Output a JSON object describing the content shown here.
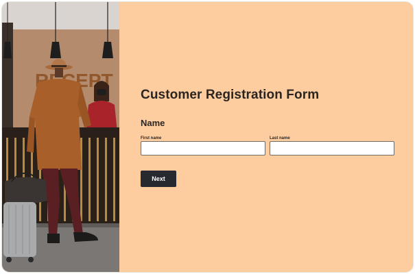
{
  "colors": {
    "background": "#fdcc9f",
    "button": "#262a2e",
    "text": "#2b2521",
    "input_border": "#6f6a66"
  },
  "photo": {
    "sign_text": "RECEPT",
    "alt": "hotel-reception-photo"
  },
  "form": {
    "title": "Customer Registration Form",
    "section_label": "Name",
    "first_name": {
      "label": "First name",
      "value": "",
      "placeholder": ""
    },
    "last_name": {
      "label": "Last name",
      "value": "",
      "placeholder": ""
    },
    "next_label": "Next"
  }
}
